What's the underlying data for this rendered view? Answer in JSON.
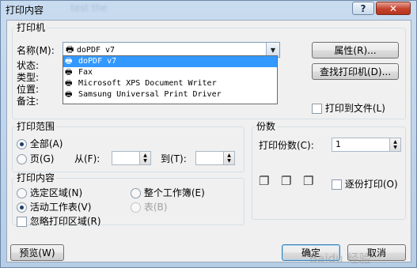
{
  "window": {
    "title": "打印内容",
    "blurred_title": "test  the",
    "help_label": "?",
    "close_label": "✕"
  },
  "printer": {
    "section_title": "打印机",
    "name_label": "名称(M):",
    "selected": "doPDF v7",
    "dropdown_options": [
      "doPDF v7",
      "Fax",
      "Microsoft XPS Document Writer",
      "Samsung Universal Print Driver"
    ],
    "status_label": "状态:",
    "type_label": "类型:",
    "location_label": "位置:",
    "comment_label": "备注:",
    "properties_button": "属性(R)...",
    "find_button": "查找打印机(D)...",
    "print_to_file_label": "打印到文件(L)"
  },
  "range": {
    "section_title": "打印范围",
    "all_label": "全部(A)",
    "pages_label": "页(G)",
    "from_label": "从(F):",
    "to_label": "到(T):",
    "from_value": "",
    "to_value": ""
  },
  "copies": {
    "section_title": "份数",
    "count_label": "打印份数(C):",
    "count_value": "1",
    "collate_label": "逐份打印(O)"
  },
  "content": {
    "section_title": "打印内容",
    "selection_label": "选定区域(N)",
    "workbook_label": "整个工作簿(E)",
    "active_sheet_label": "活动工作表(V)",
    "table_label": "表(B)",
    "ignore_area_label": "忽略打印区域(R)"
  },
  "footer": {
    "preview_button": "预览(W)",
    "ok_button": "确定",
    "cancel_button": "取消"
  },
  "watermark": "Baidu 经验",
  "colors": {
    "selection": "#3399ff",
    "title_bar": "#c9dcef",
    "close_button": "#c4422d"
  }
}
